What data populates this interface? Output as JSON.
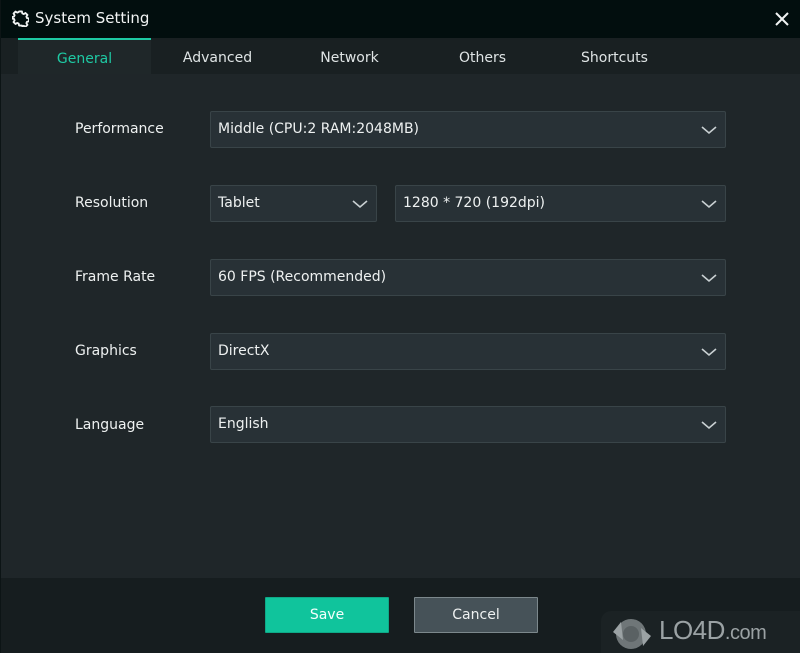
{
  "window": {
    "title": "System Setting",
    "icon": "gear-icon",
    "close_icon": "close-icon"
  },
  "tabs": [
    {
      "label": "General",
      "active": true
    },
    {
      "label": "Advanced",
      "active": false
    },
    {
      "label": "Network",
      "active": false
    },
    {
      "label": "Others",
      "active": false
    },
    {
      "label": "Shortcuts",
      "active": false
    }
  ],
  "settings": {
    "performance": {
      "label": "Performance",
      "value": "Middle (CPU:2 RAM:2048MB)"
    },
    "resolution": {
      "label": "Resolution",
      "device_value": "Tablet",
      "size_value": "1280 * 720 (192dpi)"
    },
    "frame_rate": {
      "label": "Frame Rate",
      "value": "60 FPS (Recommended)"
    },
    "graphics": {
      "label": "Graphics",
      "value": "DirectX"
    },
    "language": {
      "label": "Language",
      "value": "English"
    }
  },
  "footer": {
    "save_label": "Save",
    "cancel_label": "Cancel"
  },
  "watermark": {
    "brand": "LO4D",
    "suffix": ".com"
  },
  "colors": {
    "accent": "#1ec9a3",
    "save_button": "#10c49c",
    "cancel_button": "#465258",
    "titlebar": "#020e0e",
    "content_bg": "#1f2629",
    "select_bg": "#283136"
  }
}
